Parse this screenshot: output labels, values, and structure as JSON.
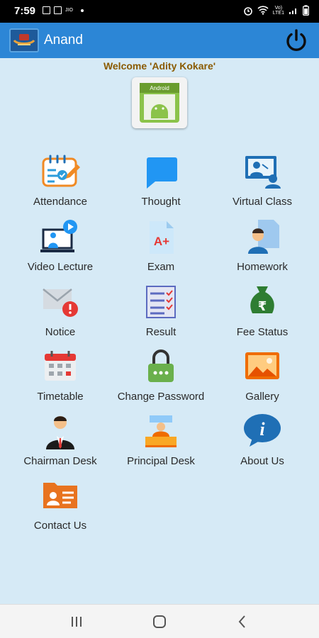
{
  "status_bar": {
    "time": "7:59",
    "network": "Vo) LTE1",
    "lte_top": "Vo)",
    "lte_bottom": "LTE1",
    "jio_label": "JIO"
  },
  "app_bar": {
    "title": "Anand"
  },
  "welcome_text": "Welcome  'Adity Kokare'",
  "avatar_tag": "Android",
  "menu": [
    {
      "label": "Attendance",
      "icon": "attendance-icon"
    },
    {
      "label": "Thought",
      "icon": "chat-bubble-icon"
    },
    {
      "label": "Virtual Class",
      "icon": "virtual-class-icon"
    },
    {
      "label": "Video Lecture",
      "icon": "video-lecture-icon"
    },
    {
      "label": "Exam",
      "icon": "exam-grade-icon"
    },
    {
      "label": "Homework",
      "icon": "homework-icon"
    },
    {
      "label": "Notice",
      "icon": "notice-mail-icon"
    },
    {
      "label": "Result",
      "icon": "result-checklist-icon"
    },
    {
      "label": "Fee Status",
      "icon": "money-bag-icon"
    },
    {
      "label": "Timetable",
      "icon": "calendar-icon"
    },
    {
      "label": "Change Password",
      "icon": "lock-icon"
    },
    {
      "label": "Gallery",
      "icon": "gallery-image-icon"
    },
    {
      "label": "Chairman Desk",
      "icon": "chairman-icon"
    },
    {
      "label": "Principal Desk",
      "icon": "principal-desk-icon"
    },
    {
      "label": "About Us",
      "icon": "info-icon"
    },
    {
      "label": "Contact Us",
      "icon": "contact-card-icon"
    }
  ],
  "colors": {
    "app_bar": "#2c86d6",
    "background": "#d6eaf6",
    "welcome": "#8a5a00"
  }
}
